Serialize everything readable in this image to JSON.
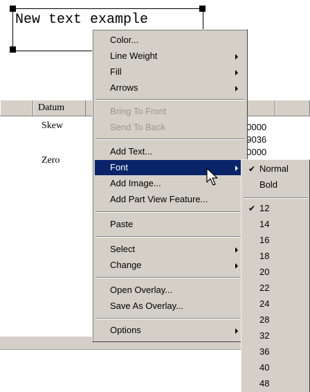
{
  "canvas": {
    "text_box_value": "New text example"
  },
  "table": {
    "header": {
      "datum": "Datum"
    },
    "rows": [
      {
        "label": "Skew",
        "values": [
          "00000",
          "39036"
        ]
      },
      {
        "label": "Zero",
        "values": [
          "00000"
        ]
      }
    ]
  },
  "context_menu": {
    "items": [
      {
        "label": "Color...",
        "has_submenu": false,
        "enabled": true
      },
      {
        "label": "Line Weight",
        "has_submenu": true,
        "enabled": true
      },
      {
        "label": "Fill",
        "has_submenu": true,
        "enabled": true
      },
      {
        "label": "Arrows",
        "has_submenu": true,
        "enabled": true
      },
      {
        "label": "Bring To Front",
        "has_submenu": false,
        "enabled": false
      },
      {
        "label": "Send To Back",
        "has_submenu": false,
        "enabled": false
      },
      {
        "label": "Add Text...",
        "has_submenu": false,
        "enabled": true
      },
      {
        "label": "Font",
        "has_submenu": true,
        "enabled": true,
        "selected": true
      },
      {
        "label": "Add Image...",
        "has_submenu": false,
        "enabled": true
      },
      {
        "label": "Add Part View Feature...",
        "has_submenu": false,
        "enabled": true
      },
      {
        "label": "Paste",
        "has_submenu": false,
        "enabled": true
      },
      {
        "label": "Select",
        "has_submenu": true,
        "enabled": true
      },
      {
        "label": "Change",
        "has_submenu": true,
        "enabled": true
      },
      {
        "label": "Open Overlay...",
        "has_submenu": false,
        "enabled": true
      },
      {
        "label": "Save As Overlay...",
        "has_submenu": false,
        "enabled": true
      },
      {
        "label": "Options",
        "has_submenu": true,
        "enabled": true
      }
    ]
  },
  "font_submenu": {
    "styles": [
      {
        "label": "Normal",
        "checked": true
      },
      {
        "label": "Bold",
        "checked": false
      }
    ],
    "sizes": [
      {
        "label": "12",
        "checked": true
      },
      {
        "label": "14",
        "checked": false
      },
      {
        "label": "16",
        "checked": false
      },
      {
        "label": "18",
        "checked": false
      },
      {
        "label": "20",
        "checked": false
      },
      {
        "label": "22",
        "checked": false
      },
      {
        "label": "24",
        "checked": false
      },
      {
        "label": "28",
        "checked": false
      },
      {
        "label": "32",
        "checked": false
      },
      {
        "label": "36",
        "checked": false
      },
      {
        "label": "40",
        "checked": false
      },
      {
        "label": "48",
        "checked": false
      }
    ],
    "check_glyph": "✔"
  },
  "colors": {
    "menu_background": "#d4d0c8",
    "selection": "#0a246a",
    "disabled_text": "#9a968c"
  }
}
